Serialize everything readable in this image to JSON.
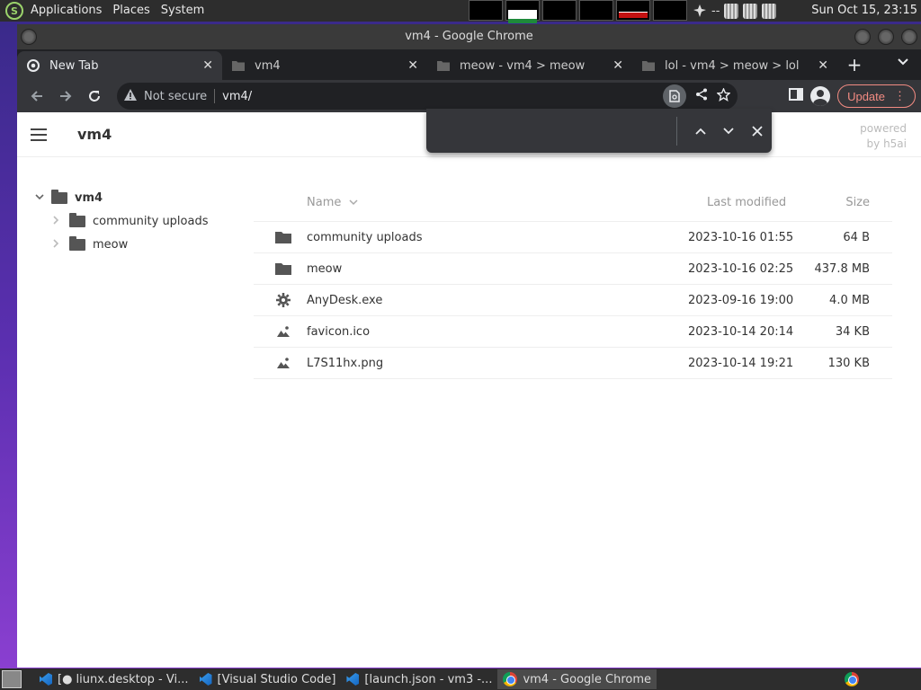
{
  "top_panel": {
    "menus": [
      "Applications",
      "Places",
      "System"
    ],
    "tray_text": "--",
    "clock": "Sun Oct 15, 23:15"
  },
  "window": {
    "title": "vm4 - Google Chrome"
  },
  "tabs": [
    {
      "title": "New Tab",
      "icon": "chrome-icon",
      "active": true
    },
    {
      "title": "vm4",
      "icon": "folder-icon",
      "active": false
    },
    {
      "title": "meow - vm4 > meow",
      "icon": "folder-icon",
      "active": false
    },
    {
      "title": "lol - vm4 > meow > lol",
      "icon": "folder-icon",
      "active": false
    }
  ],
  "toolbar": {
    "security_label": "Not secure",
    "url": "vm4/",
    "update_label": "Update"
  },
  "findbar": {
    "value": ""
  },
  "h5ai": {
    "breadcrumb": "vm4",
    "powered_line1": "powered",
    "powered_line2": "by h5ai",
    "tree": {
      "root": "vm4",
      "children": [
        "community uploads",
        "meow"
      ]
    },
    "columns": {
      "name": "Name",
      "modified": "Last modified",
      "size": "Size"
    },
    "files": [
      {
        "name": "community uploads",
        "icon": "folder-icon",
        "modified": "2023-10-16 01:55",
        "size": "64 B"
      },
      {
        "name": "meow",
        "icon": "folder-icon",
        "modified": "2023-10-16 02:25",
        "size": "437.8 MB"
      },
      {
        "name": "AnyDesk.exe",
        "icon": "gear-icon",
        "modified": "2023-09-16 19:00",
        "size": "4.0 MB"
      },
      {
        "name": "favicon.ico",
        "icon": "image-icon",
        "modified": "2023-10-14 20:14",
        "size": "34 KB"
      },
      {
        "name": "L7S11hx.png",
        "icon": "image-icon",
        "modified": "2023-10-14 19:21",
        "size": "130 KB"
      }
    ]
  },
  "taskbar": [
    {
      "label": "[● liunx.desktop - Vi...",
      "icon": "vscode-icon",
      "active": false
    },
    {
      "label": "[Visual Studio Code]",
      "icon": "vscode-icon",
      "active": false
    },
    {
      "label": "[launch.json - vm3 -...",
      "icon": "vscode-icon",
      "active": false
    },
    {
      "label": "vm4 - Google Chrome",
      "icon": "chrome-icon",
      "active": true
    }
  ]
}
